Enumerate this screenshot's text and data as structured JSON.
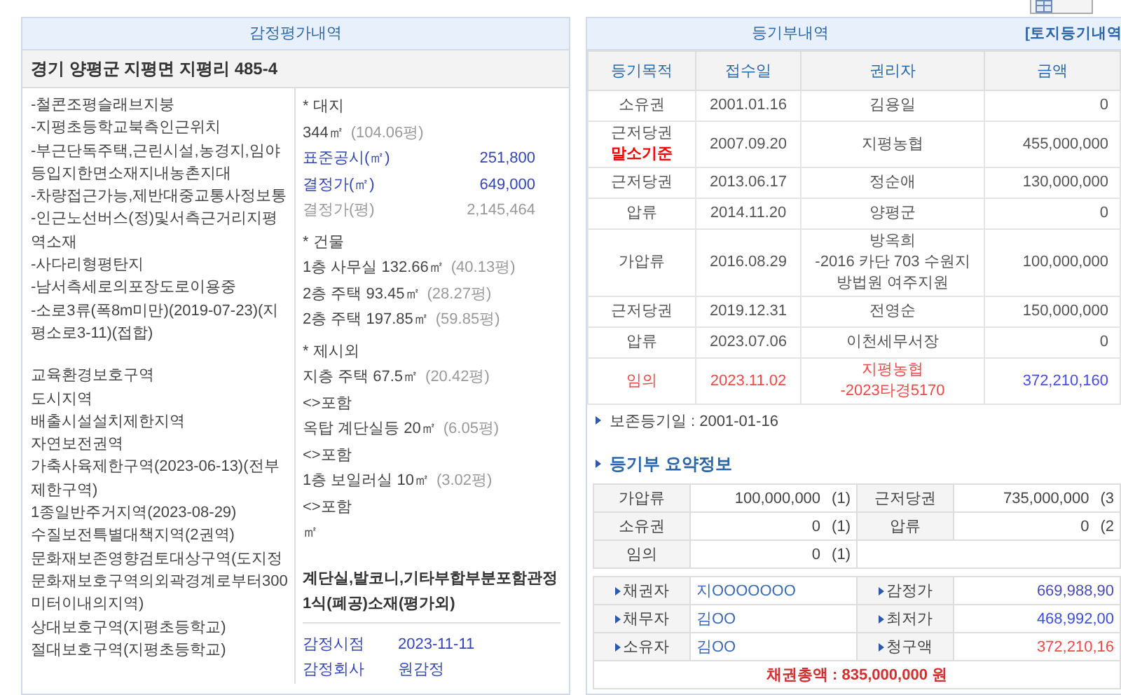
{
  "appraisal": {
    "title": "감정평가내역",
    "address": "경기 양평군 지평면 지평리 485-4",
    "notes": [
      "-철콘조평슬래브지붕",
      "-지평초등학교북측인근위치",
      "-부근단독주택,근린시설,농경지,임야등입지한면소재지내농촌지대",
      "-차량접근가능,제반대중교통사정보통",
      "-인근노선버스(정)및서측근거리지평역소재",
      "-사다리형평탄지",
      "-남서측세로의포장도로이용중",
      "-소로3류(폭8m미만)(2019-07-23)(지평소로3-11)(접합)"
    ],
    "zones": [
      "교육환경보호구역",
      "도시지역",
      "배출시설설치제한지역",
      "자연보전권역",
      "가축사육제한구역(2023-06-13)(전부제한구역)",
      "1종일반주거지역(2023-08-29)",
      "수질보전특별대책지역(2권역)",
      "문화재보존영향검토대상구역(도지정",
      "문화재보호구역의외곽경계로부터300미터이내의지역)",
      "상대보호구역(지평초등학교)",
      "절대보호구역(지평초등학교)"
    ],
    "sections": [
      {
        "heading": "* 대지",
        "lines": [
          {
            "text": "344㎡",
            "area": "(104.06평)"
          }
        ],
        "prices": [
          {
            "label": "표준공시(㎡)",
            "value": "251,800",
            "kind": "highlight"
          },
          {
            "label": "결정가(㎡)",
            "value": "649,000",
            "kind": "highlight"
          },
          {
            "label": "결정가(평)",
            "value": "2,145,464",
            "kind": "muted"
          }
        ]
      },
      {
        "heading": "* 건물",
        "lines": [
          {
            "text": "1층 사무실 132.66㎡",
            "area": "(40.13평)"
          },
          {
            "text": "2층 주택 93.45㎡",
            "area": "(28.27평)"
          },
          {
            "text": "2층 주택 197.85㎡",
            "area": "(59.85평)"
          }
        ]
      },
      {
        "heading": "* 제시외",
        "lines": [
          {
            "text": "지층 주택 67.5㎡",
            "area": "(20.42평)"
          },
          {
            "text": "<>포함"
          },
          {
            "text": "옥탑 계단실등 20㎡",
            "area": "(6.05평)"
          },
          {
            "text": "<>포함"
          },
          {
            "text": "1층 보일러실 10㎡",
            "area": "(3.02평)"
          },
          {
            "text": "<>포함"
          },
          {
            "text": "㎡"
          }
        ]
      }
    ],
    "remark": "계단실,발코니,기타부합부분포함관정1식(폐공)소재(평가외)",
    "info": [
      {
        "label": "감정시점",
        "value": "2023-11-11"
      },
      {
        "label": "감정회사",
        "value": "원감정"
      }
    ]
  },
  "registry": {
    "title": "등기부내역",
    "link": "[토지등기내역",
    "columns": [
      "등기목적",
      "접수일",
      "권리자",
      "금액"
    ],
    "rows": [
      {
        "purpose": "소유권",
        "date": "2001.01.16",
        "holder": [
          "김용일"
        ],
        "amount": "0",
        "highlighted": false
      },
      {
        "purpose": "근저당권",
        "note": "말소기준",
        "date": "2007.09.20",
        "holder": [
          "지평농협"
        ],
        "amount": "455,000,000",
        "highlighted": false
      },
      {
        "purpose": "근저당권",
        "date": "2013.06.17",
        "holder": [
          "정순애"
        ],
        "amount": "130,000,000",
        "highlighted": false
      },
      {
        "purpose": "압류",
        "date": "2014.11.20",
        "holder": [
          "양평군"
        ],
        "amount": "0",
        "highlighted": false
      },
      {
        "purpose": "가압류",
        "date": "2016.08.29",
        "holder": [
          "방옥희",
          "-2016 카단 703 수원지방법원 여주지원"
        ],
        "amount": "100,000,000",
        "highlighted": false
      },
      {
        "purpose": "근저당권",
        "date": "2019.12.31",
        "holder": [
          "전영순"
        ],
        "amount": "150,000,000",
        "highlighted": false
      },
      {
        "purpose": "압류",
        "date": "2023.07.06",
        "holder": [
          "이천세무서장"
        ],
        "amount": "0",
        "highlighted": false
      },
      {
        "purpose": "임의",
        "date": "2023.11.02",
        "holder": [
          "지평농협",
          "-2023타경5170"
        ],
        "amount": "372,210,160",
        "highlighted": true
      }
    ],
    "preservation": "보존등기일 : 2001-01-16",
    "summary_title": "등기부 요약정보",
    "summary": [
      [
        {
          "label": "가압류",
          "amount": "100,000,000",
          "count": "(1)"
        },
        {
          "label": "근저당권",
          "amount": "735,000,000",
          "count": "(3"
        }
      ],
      [
        {
          "label": "소유권",
          "amount": "0",
          "count": "(1)"
        },
        {
          "label": "압류",
          "amount": "0",
          "count": "(2"
        }
      ],
      [
        {
          "label": "임의",
          "amount": "0",
          "count": "(1)"
        }
      ]
    ],
    "parties": [
      {
        "label": "채권자",
        "name": "지OOOOOOO",
        "price_label": "감정가",
        "price": "669,988,90",
        "color": "#4a4ab8"
      },
      {
        "label": "채무자",
        "name": "김OO",
        "price_label": "최저가",
        "price": "468,992,00",
        "color": "#3b4fe0"
      },
      {
        "label": "소유자",
        "name": "김OO",
        "price_label": "청구액",
        "price": "372,210,16",
        "color": "#f04848"
      }
    ],
    "total": "채권총액 : 835,000,000 원"
  }
}
